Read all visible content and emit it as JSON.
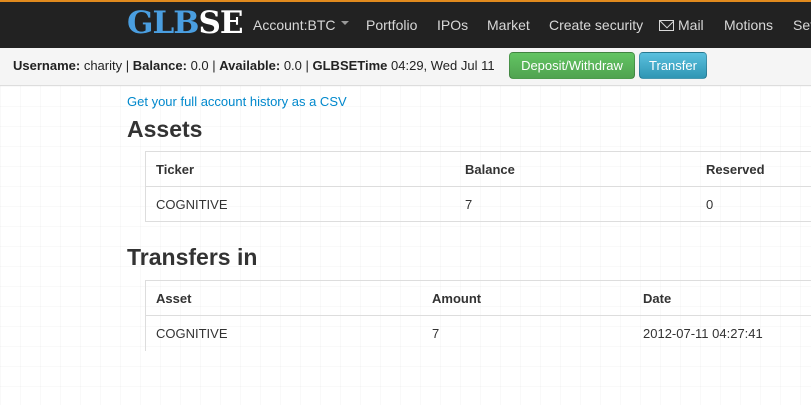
{
  "header": {
    "logo_part1": "GLB",
    "logo_part2": "SE",
    "nav": [
      "Account:BTC",
      "Portfolio",
      "IPOs",
      "Market",
      "Create security",
      "Mail",
      "Motions",
      "Set"
    ]
  },
  "status_bar": {
    "username_label": "Username:",
    "username": "charity",
    "balance_label": "Balance:",
    "balance": "0.0",
    "available_label": "Available:",
    "available": "0.0",
    "time_label": "GLBSETime",
    "time": "04:29, Wed Jul 11",
    "deposit_button": "Deposit/Withdraw",
    "transfer_button": "Transfer"
  },
  "csv_link": "Get your full account history as a CSV",
  "assets": {
    "title": "Assets",
    "columns": [
      "Ticker",
      "Balance",
      "Reserved"
    ],
    "rows": [
      [
        "COGNITIVE",
        "7",
        "0"
      ]
    ]
  },
  "transfers_in": {
    "title": "Transfers in",
    "columns": [
      "Asset",
      "Amount",
      "Date"
    ],
    "rows": [
      [
        "COGNITIVE",
        "7",
        "2012-07-11 04:27:41"
      ]
    ]
  },
  "colors": {
    "topbar": "#222222",
    "accent_orange": "#e08a1e",
    "logo_blue": "#4a9ee0",
    "link_blue": "#0088cc",
    "button_green": "#51a351",
    "button_blue": "#2f96b4"
  }
}
